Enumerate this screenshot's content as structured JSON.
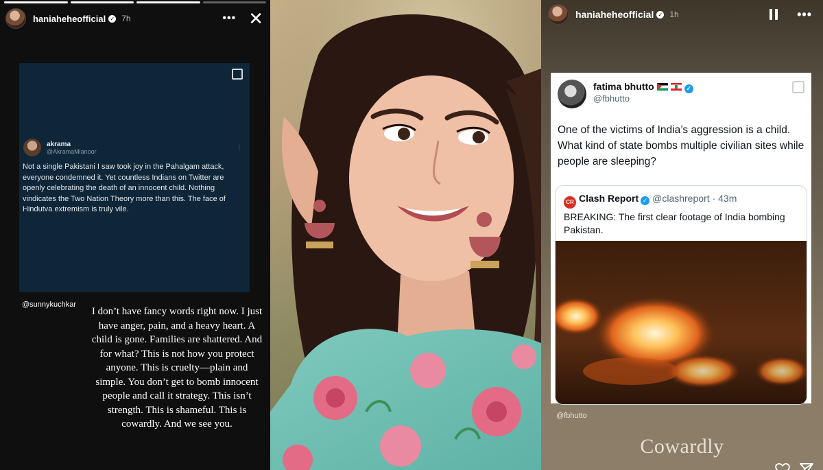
{
  "left_story": {
    "username": "haniaheheofficial",
    "verified_icon": "verified-badge-icon",
    "time": "7h",
    "menu_icon": "more-options-icon",
    "close_icon": "close-icon",
    "tweet": {
      "name": "akrama",
      "handle": "@AkramaMianoor",
      "text": "Not a single Pakistani I saw took joy in the Pahalgam attack, everyone condemned it. Yet countless Indians on Twitter are openly celebrating the death of an innocent child. Nothing vindicates the Two Nation Theory more than this. The face of Hindutva extremism is truly vile."
    },
    "mention": "@sunnykuchkar",
    "caption": "I don’t have fancy words right now. I just have anger, pain, and a heavy heart. A child is gone. Families are shattered. And for what? This is not how you protect anyone. This is cruelty—plain and simple. You don’t get to bomb innocent people and call it strategy. This isn’t strength. This is shameful. This is cowardly. And we see you."
  },
  "right_story": {
    "username": "haniaheheofficial",
    "time": "1h",
    "tweet": {
      "name": "fatima bhutto",
      "handle": "@fbhutto",
      "text": "One of the victims of India’s aggression is a child. What kind of state bombs multiple civilian sites while people are sleeping?",
      "quote": {
        "name": "Clash Report",
        "handle": "@clashreport",
        "time": "· 43m",
        "text": "BREAKING: The first clear footage of India bombing Pakistan."
      }
    },
    "mention": "@fbhutto",
    "caption": "Cowardly"
  },
  "colors": {
    "story_bg": "#0f0f0f",
    "tweet_card_bg": "#0e2638",
    "verify_blue": "#1d9bf0"
  }
}
